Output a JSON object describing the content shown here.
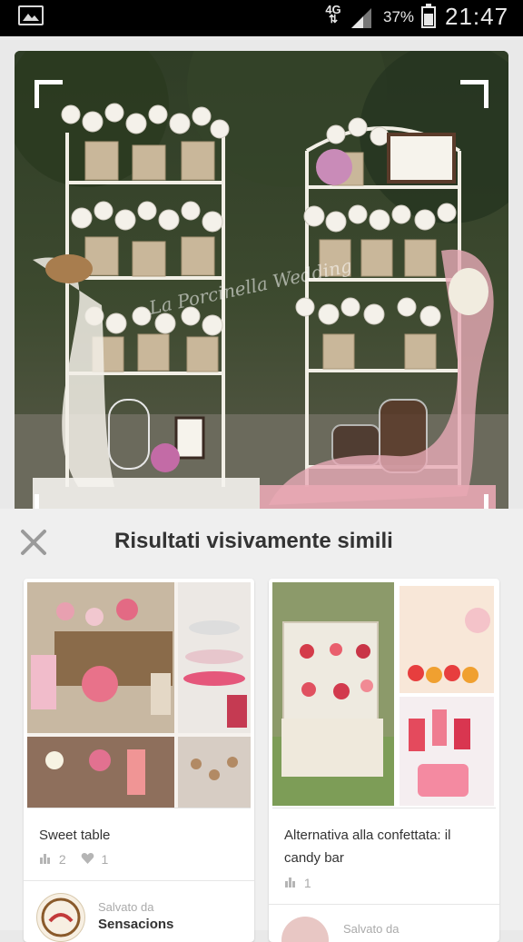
{
  "status_bar": {
    "network": "4G",
    "network_arrows": "⇅",
    "battery_percent": "37%",
    "time": "21:47"
  },
  "hero": {
    "watermark": "La Porcinella Wedding"
  },
  "results": {
    "title": "Risultati visivamente simili",
    "cards": [
      {
        "title": "Sweet table",
        "repins": "2",
        "likes": "1",
        "saved_label": "Salvato da",
        "saved_by": "Sensacions"
      },
      {
        "title": "Alternativa alla confettata: il candy bar",
        "repins": "1",
        "saved_label": "Salvato da"
      }
    ]
  },
  "colors": {
    "status_bg": "#000000",
    "panel_bg": "#efefef",
    "title_text": "#333333",
    "muted_text": "#aaaaaa"
  }
}
